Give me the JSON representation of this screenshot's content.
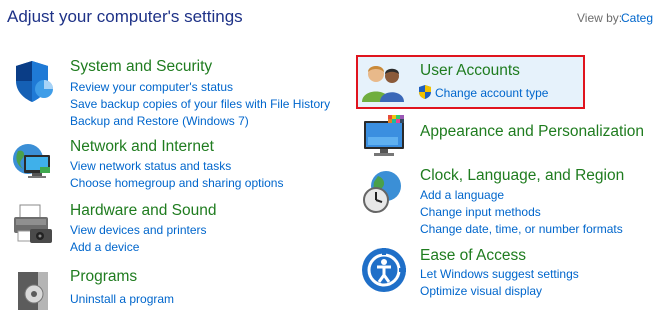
{
  "header": {
    "title": "Adjust your computer's settings",
    "view_by_label": "View by:",
    "view_by_value": "Categ"
  },
  "categories": {
    "system": {
      "title": "System and Security",
      "links": [
        "Review your computer's status",
        "Save backup copies of your files with File History",
        "Backup and Restore (Windows 7)"
      ],
      "icon": "shield-icon"
    },
    "network": {
      "title": "Network and Internet",
      "links": [
        "View network status and tasks",
        "Choose homegroup and sharing options"
      ],
      "icon": "network-globe-icon"
    },
    "hardware": {
      "title": "Hardware and Sound",
      "links": [
        "View devices and printers",
        "Add a device"
      ],
      "icon": "printer-icon"
    },
    "programs": {
      "title": "Programs",
      "links": [
        "Uninstall a program"
      ],
      "icon": "programs-box-icon"
    },
    "users": {
      "title": "User Accounts",
      "links": [
        "Change account type"
      ],
      "icon": "users-icon"
    },
    "appearance": {
      "title": "Appearance and Personalization",
      "links": [],
      "icon": "monitor-palette-icon"
    },
    "clock": {
      "title": "Clock, Language, and Region",
      "links": [
        "Add a language",
        "Change input methods",
        "Change date, time, or number formats"
      ],
      "icon": "clock-globe-icon"
    },
    "ease": {
      "title": "Ease of Access",
      "links": [
        "Let Windows suggest settings",
        "Optimize visual display"
      ],
      "icon": "ease-of-access-icon"
    }
  },
  "colors": {
    "heading_green": "#1f7c1f",
    "link_blue": "#0066cc",
    "title_blue": "#1e3287",
    "highlight_red": "#e0141e"
  }
}
